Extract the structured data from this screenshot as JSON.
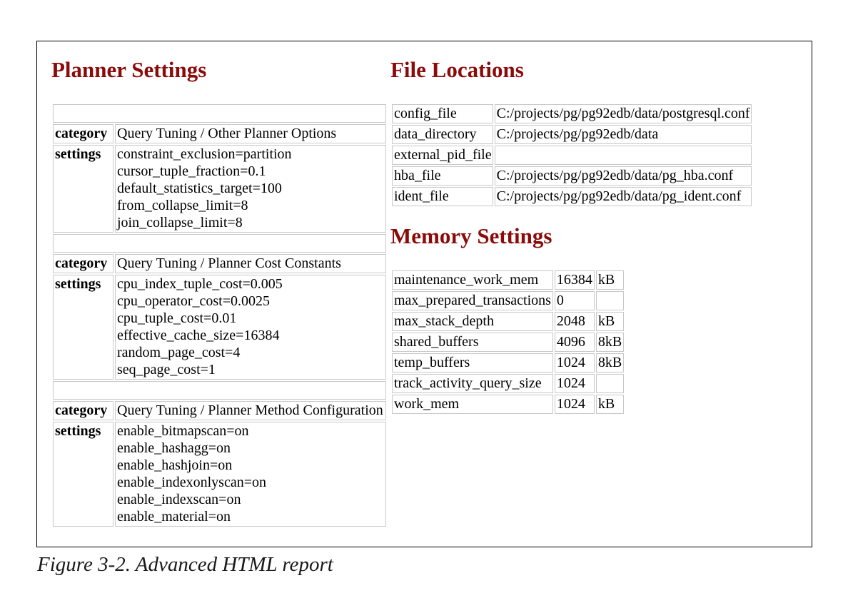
{
  "planner": {
    "title": "Planner Settings",
    "groups": [
      {
        "category_label": "category",
        "category": "Query Tuning / Other Planner Options",
        "settings_label": "settings",
        "settings": [
          "constraint_exclusion=partition",
          "cursor_tuple_fraction=0.1",
          "default_statistics_target=100",
          "from_collapse_limit=8",
          "join_collapse_limit=8"
        ]
      },
      {
        "category_label": "category",
        "category": "Query Tuning / Planner Cost Constants",
        "settings_label": "settings",
        "settings": [
          "cpu_index_tuple_cost=0.005",
          "cpu_operator_cost=0.0025",
          "cpu_tuple_cost=0.01",
          "effective_cache_size=16384",
          "random_page_cost=4",
          "seq_page_cost=1"
        ]
      },
      {
        "category_label": "category",
        "category": "Query Tuning / Planner Method Configuration",
        "settings_label": "settings",
        "settings": [
          "enable_bitmapscan=on",
          "enable_hashagg=on",
          "enable_hashjoin=on",
          "enable_indexonlyscan=on",
          "enable_indexscan=on",
          "enable_material=on"
        ]
      }
    ]
  },
  "file_locations": {
    "title": "File Locations",
    "rows": [
      {
        "name": "config_file",
        "value": "C:/projects/pg/pg92edb/data/postgresql.conf"
      },
      {
        "name": "data_directory",
        "value": "C:/projects/pg/pg92edb/data"
      },
      {
        "name": "external_pid_file",
        "value": ""
      },
      {
        "name": "hba_file",
        "value": "C:/projects/pg/pg92edb/data/pg_hba.conf"
      },
      {
        "name": "ident_file",
        "value": "C:/projects/pg/pg92edb/data/pg_ident.conf"
      }
    ]
  },
  "memory": {
    "title": "Memory Settings",
    "rows": [
      {
        "name": "maintenance_work_mem",
        "value": "16384",
        "unit": "kB"
      },
      {
        "name": "max_prepared_transactions",
        "value": "0",
        "unit": ""
      },
      {
        "name": "max_stack_depth",
        "value": "2048",
        "unit": "kB"
      },
      {
        "name": "shared_buffers",
        "value": "4096",
        "unit": "8kB"
      },
      {
        "name": "temp_buffers",
        "value": "1024",
        "unit": "8kB"
      },
      {
        "name": "track_activity_query_size",
        "value": "1024",
        "unit": ""
      },
      {
        "name": "work_mem",
        "value": "1024",
        "unit": "kB"
      }
    ]
  },
  "caption": "Figure 3-2. Advanced HTML report"
}
